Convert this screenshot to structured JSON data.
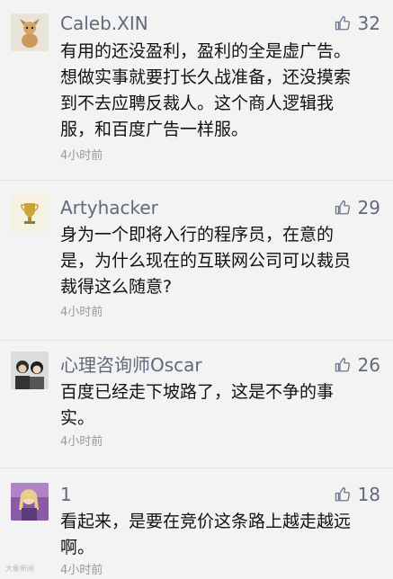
{
  "comments": [
    {
      "name": "Caleb.XIN",
      "likes": "32",
      "lines": [
        "有用的还没盈利，盈利的全是虚广告。",
        "想做实事就要打长久战准备，还没摸索",
        "到不去应聘反裁人。这个商人逻辑我",
        "服，和百度广告一样服。"
      ],
      "time": "4小时前",
      "avatar_icon": "dog-avatar-icon"
    },
    {
      "name": "Artyhacker",
      "likes": "29",
      "lines": [
        "身为一个即将入行的程序员，在意的",
        "是，为什么现在的互联网公司可以裁员",
        "裁得这么随意?"
      ],
      "time": "4小时前",
      "avatar_icon": "trophy-avatar-icon"
    },
    {
      "name": "心理咨询师Oscar",
      "likes": "26",
      "lines": [
        "百度已经走下坡路了，这是不争的事",
        "实。"
      ],
      "time": "4小时前",
      "avatar_icon": "couple-photo-avatar-icon"
    },
    {
      "name": "1",
      "likes": "18",
      "lines": [
        "看起来，是要在竞价这条路上越走越远",
        "啊。"
      ],
      "time": "4小时前",
      "avatar_icon": "girl-photo-avatar-icon"
    }
  ],
  "watermark": "大象新闻",
  "colors": {
    "background": "#f3f3f3",
    "name": "#5f6b7c",
    "time": "#9a9a9a",
    "text": "#111111"
  }
}
